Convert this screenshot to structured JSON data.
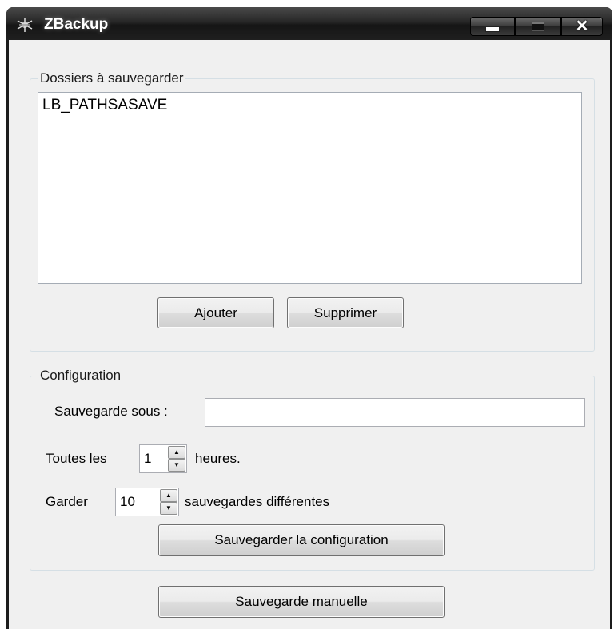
{
  "window": {
    "title": "ZBackup",
    "minimize_icon": "minimize-icon",
    "maximize_icon": "maximize-icon",
    "close_icon": "close-icon",
    "close_glyph": "✕"
  },
  "folders_group": {
    "legend": "Dossiers à sauvegarder",
    "list_items": [
      "LB_PATHSASAVE"
    ],
    "add_label": "Ajouter",
    "remove_label": "Supprimer"
  },
  "config_group": {
    "legend": "Configuration",
    "save_under_label": "Sauvegarde sous :",
    "save_under_value": "",
    "every_label": "Toutes les",
    "every_value": "1",
    "hours_label": "heures.",
    "keep_label": "Garder",
    "keep_value": "10",
    "backups_label": "sauvegardes différentes",
    "save_config_label": "Sauvegarder la configuration"
  },
  "manual_backup_label": "Sauvegarde manuelle",
  "spin_up_glyph": "▲",
  "spin_down_glyph": "▼"
}
